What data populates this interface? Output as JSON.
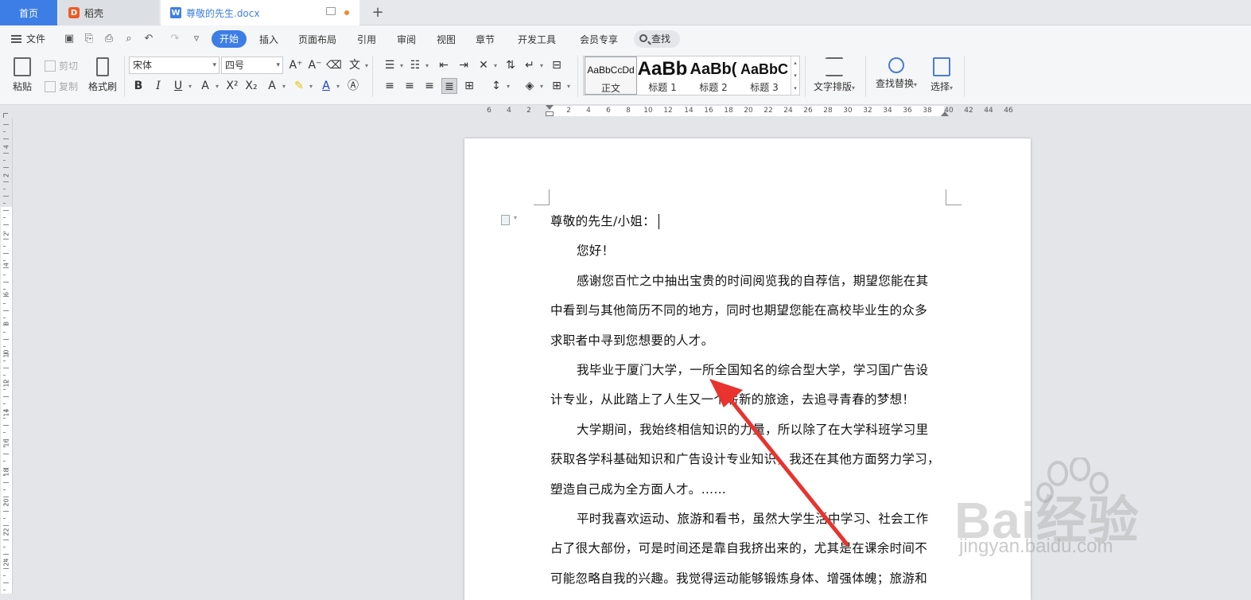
{
  "tabs": {
    "home": "首页",
    "daoke": "稻壳",
    "document": "尊敬的先生.docx"
  },
  "menu": {
    "file": "文件",
    "active": "开始",
    "items": [
      "插入",
      "页面布局",
      "引用",
      "审阅",
      "视图",
      "章节",
      "开发工具",
      "会员专享"
    ],
    "search": "查找"
  },
  "ribbon": {
    "paste": "粘贴",
    "cut": "剪切",
    "copy": "复制",
    "format_painter": "格式刷",
    "font_name": "宋体",
    "font_size": "四号",
    "styles": [
      {
        "sample": "AaBbCcDd",
        "label": "正文",
        "selected": true
      },
      {
        "sample": "AaBb",
        "label": "标题 1"
      },
      {
        "sample": "AaBb(",
        "label": "标题 2"
      },
      {
        "sample": "AaBbC",
        "label": "标题 3"
      }
    ],
    "text_layout": "文字排版",
    "find_replace": "查找替换",
    "select": "选择"
  },
  "ruler": {
    "h_numbers": [
      "6",
      "4",
      "2",
      "2",
      "4",
      "6",
      "8",
      "10",
      "12",
      "14",
      "16",
      "18",
      "20",
      "22",
      "24",
      "26",
      "28",
      "30",
      "32",
      "34",
      "36",
      "38",
      "40",
      "42",
      "44",
      "46"
    ],
    "v_numbers": [
      "4",
      "2",
      "2",
      "4",
      "6",
      "8",
      "10",
      "12",
      "14",
      "16",
      "18",
      "20",
      "22",
      "24"
    ]
  },
  "document": {
    "lines": [
      "尊敬的先生/小姐：",
      "您好！",
      "感谢您百忙之中抽出宝贵的时间阅览我的自荐信，期望您能在其",
      "中看到与其他简历不同的地方，同时也期望您能在高校毕业生的众多",
      "求职者中寻到您想要的人才。",
      "我毕业于厦门大学，一所全国知名的综合型大学，学习国广告设",
      "计专业，从此踏上了人生又一个崭新的旅途，去追寻青春的梦想！",
      "大学期间，我始终相信知识的力量，所以除了在大学科班学习里",
      "获取各学科基础知识和广告设计专业知识，我还在其他方面努力学习，",
      "塑造自己成为全方面人才。……",
      "平时我喜欢运动、旅游和看书，虽然大学生活中学习、社会工作",
      "占了很大部份，可是时间还是靠自我挤出来的，尤其是在课余时间不",
      "可能忽略自我的兴趣。我觉得运动能够锻炼身体、增强体魄；旅游和"
    ]
  },
  "watermark": {
    "text": "Bai经验",
    "url": "jingyan.baidu.com"
  },
  "colors": {
    "accent": "#3d7ee6",
    "arrow": "#e8332f"
  }
}
